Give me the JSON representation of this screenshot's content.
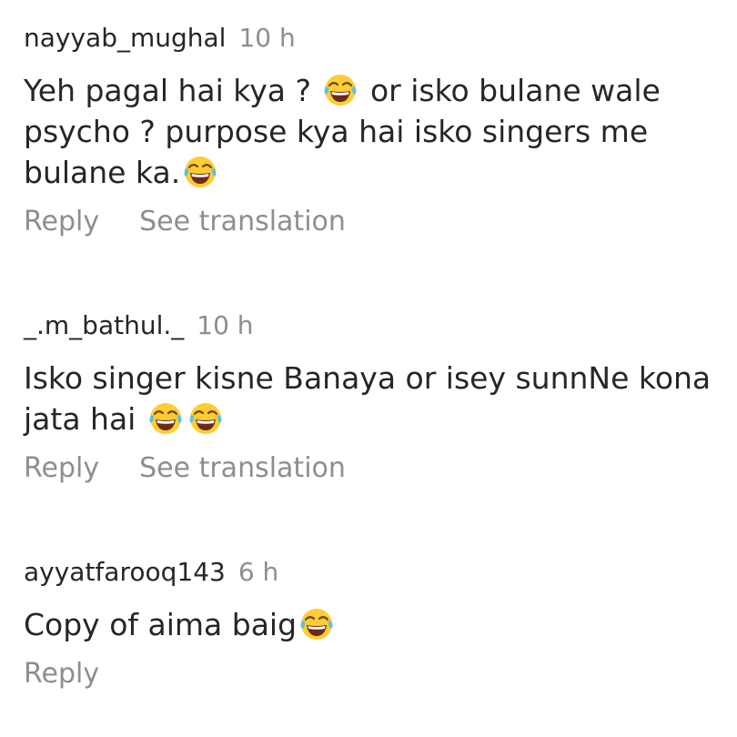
{
  "comments": [
    {
      "username": "nayyab_mughal",
      "time": "10 h",
      "text_parts": [
        "Yeh pagal hai kya ? ",
        " or isko bulane wale psycho ? purpose kya hai isko singers me bulane ka.",
        ""
      ],
      "emoji_icon": "face-with-tears-of-joy-icon",
      "reply_label": "Reply",
      "translate_label": "See translation"
    },
    {
      "username": "_.m_bathul._",
      "time": "10 h",
      "text_parts": [
        "Isko singer kisne Banaya or isey sunnNe kona jata hai "
      ],
      "emoji_icon": "face-with-tears-of-joy-icon",
      "reply_label": "Reply",
      "translate_label": "See translation"
    },
    {
      "username": "ayyatfarooq143",
      "time": "6 h",
      "text_parts": [
        "Copy of aima baig"
      ],
      "emoji_icon": "face-with-tears-of-joy-icon",
      "reply_label": "Reply"
    }
  ],
  "colors": {
    "text": "#262626",
    "secondary": "#8e8e8e",
    "emoji_face": "#FFCC33",
    "emoji_tears": "#5BC0EB"
  }
}
